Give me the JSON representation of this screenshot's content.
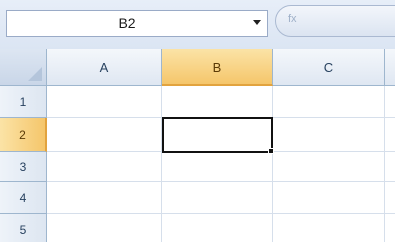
{
  "formula_bar": {
    "name_box_value": "B2",
    "fx_glyph": "fx"
  },
  "columns": [
    {
      "label": "A",
      "active": false
    },
    {
      "label": "B",
      "active": true
    },
    {
      "label": "C",
      "active": false
    },
    {
      "label": "",
      "active": false
    }
  ],
  "rows": [
    {
      "label": "1",
      "active": false
    },
    {
      "label": "2",
      "active": true
    },
    {
      "label": "3",
      "active": false
    },
    {
      "label": "4",
      "active": false
    },
    {
      "label": "5",
      "active": false
    }
  ],
  "active_cell": "B2",
  "colors": {
    "header_highlight": "#f5c66b",
    "selection_border": "#111111",
    "gridline": "#d6dfeb"
  }
}
